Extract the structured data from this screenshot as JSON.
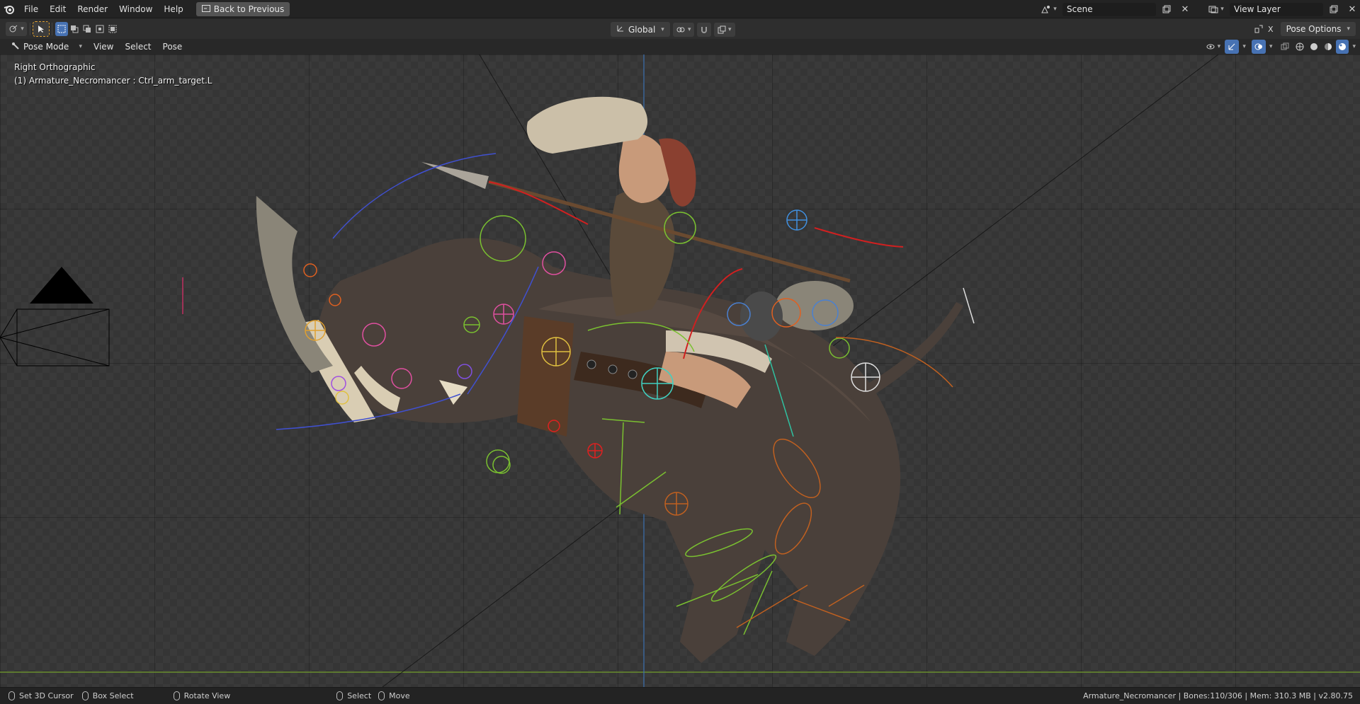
{
  "menu": {
    "file": "File",
    "edit": "Edit",
    "render": "Render",
    "window": "Window",
    "help": "Help",
    "back_button": "Back to Previous"
  },
  "scene": {
    "name": "Scene"
  },
  "view_layer": {
    "name": "View Layer"
  },
  "toolbar": {
    "orientation": "Global",
    "pose_options": "Pose Options"
  },
  "header": {
    "mode": "Pose Mode",
    "view": "View",
    "select": "Select",
    "pose": "Pose"
  },
  "viewport": {
    "view_name": "Right Orthographic",
    "active_object": "(1) Armature_Necromancer : Ctrl_arm_target.L"
  },
  "statusbar": {
    "set_cursor": "Set 3D Cursor",
    "box_select": "Box Select",
    "rotate_view": "Rotate View",
    "select": "Select",
    "move": "Move",
    "info": "Armature_Necromancer | Bones:110/306  | Mem: 310.3 MB | v2.80.75"
  },
  "colors": {
    "accent": "#4772b3",
    "background": "#2b2b2b",
    "axis_green": "#6b8f2f",
    "axis_blue": "#3b6fb0"
  }
}
